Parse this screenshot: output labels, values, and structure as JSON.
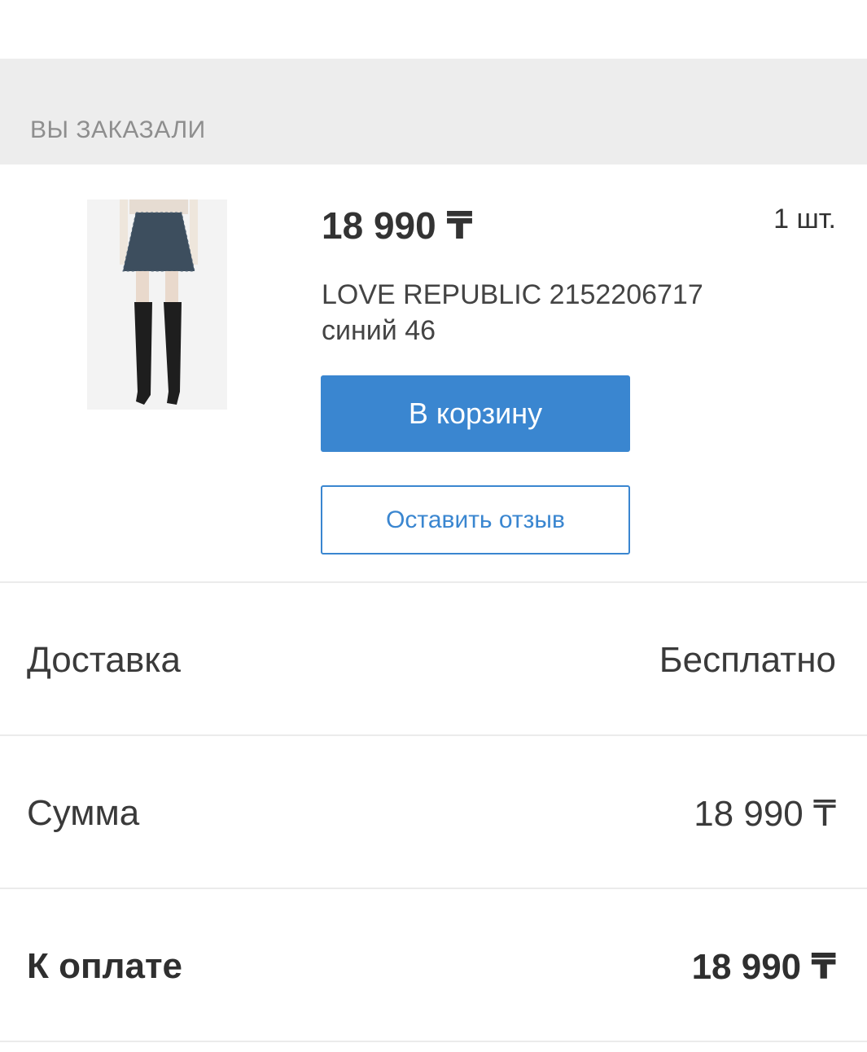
{
  "order_section": {
    "title": "ВЫ ЗАКАЗАЛИ"
  },
  "product": {
    "price": "18 990 ₸",
    "quantity": "1 шт.",
    "name": "LOVE REPUBLIC 2152206717",
    "variant": "синий 46",
    "image_alt": "product-photo-skirt",
    "add_to_cart_label": "В корзину",
    "review_label": "Оставить отзыв"
  },
  "summary": {
    "delivery_label": "Доставка",
    "delivery_value": "Бесплатно",
    "sum_label": "Сумма",
    "sum_value": "18 990 ₸",
    "total_label": "К оплате",
    "total_value": "18 990 ₸"
  },
  "colors": {
    "accent": "#3a86d0",
    "header_bg": "#ededed",
    "muted_text": "#8e8e8e"
  }
}
